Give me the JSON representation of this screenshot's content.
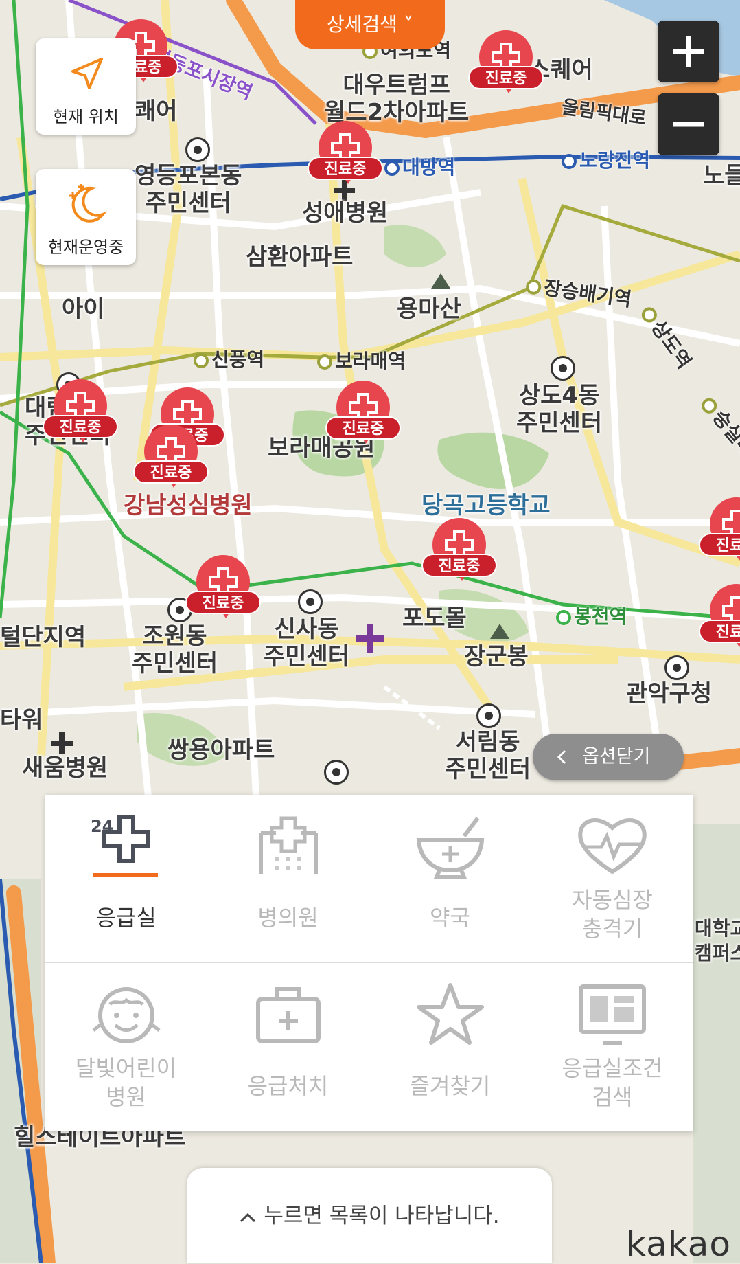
{
  "header": {
    "detail_search_label": "상세검색 ˅"
  },
  "left_buttons": {
    "current_location_label": "현재 위치",
    "now_open_label": "현재운영중"
  },
  "zoom": {
    "in_symbol": "+",
    "out_symbol": "−"
  },
  "map_labels": {
    "places": [
      "영등포본동\n주민센터",
      "성애병원",
      "삼환아파트",
      "용마산",
      "상도4동\n주민센터",
      "보라매공원",
      "당곡고등학교",
      "강남성심병원",
      "신사동\n주민센터",
      "조원동\n주민센터",
      "포도몰",
      "장군봉",
      "관악구청",
      "서림동\n주민센터",
      "쌍용아파트",
      "새움병원",
      "대우트럼프\n월드2차아파트",
      "스퀘어",
      "올림픽대로",
      "힐스테이트아파트",
      "대학교\n캠퍼스",
      "털단지역",
      "아이",
      "대림\n주민센터",
      "쾌어",
      "타워",
      "노들"
    ],
    "stations": [
      "대방역",
      "노량진역",
      "신풍역",
      "보라매역",
      "장승배기역",
      "상도역",
      "봉천역",
      "숭실대",
      "영등포시장역",
      "여의도역"
    ],
    "marker_tag": "진료중"
  },
  "options_close_label": "옵션닫기",
  "options_panel": {
    "items": [
      {
        "label": "응급실",
        "icon": "emergency-room-24-icon",
        "active": true
      },
      {
        "label": "병의원",
        "icon": "hospital-building-icon",
        "active": false
      },
      {
        "label": "약국",
        "icon": "pharmacy-bowl-icon",
        "active": false
      },
      {
        "label": "자동심장\n충격기",
        "icon": "heart-pulse-icon",
        "active": false
      },
      {
        "label": "달빛어린이\n병원",
        "icon": "child-face-icon",
        "active": false
      },
      {
        "label": "응급처치",
        "icon": "first-aid-kit-icon",
        "active": false
      },
      {
        "label": "즐겨찾기",
        "icon": "star-icon",
        "active": false
      },
      {
        "label": "응급실조건\n검색",
        "icon": "monitor-search-icon",
        "active": false
      }
    ]
  },
  "list_hint": "누르면 목록이 나타납니다.",
  "brand": "kakao",
  "colors": {
    "accent": "#f26b1d",
    "marker": "#e8464e",
    "marker_tag": "#c9202b"
  }
}
